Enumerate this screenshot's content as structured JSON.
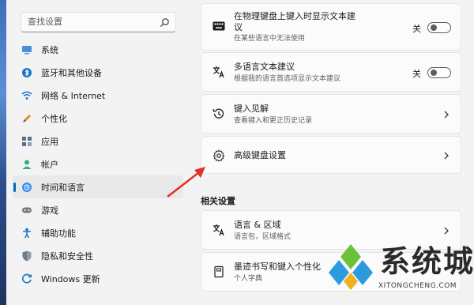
{
  "search": {
    "placeholder": "查找设置"
  },
  "sidebar": {
    "items": [
      {
        "label": "系统",
        "icon": "system-icon"
      },
      {
        "label": "蓝牙和其他设备",
        "icon": "bluetooth-icon"
      },
      {
        "label": "网络 & Internet",
        "icon": "wifi-icon"
      },
      {
        "label": "个性化",
        "icon": "personalization-icon"
      },
      {
        "label": "应用",
        "icon": "apps-icon"
      },
      {
        "label": "帐户",
        "icon": "account-icon"
      },
      {
        "label": "时间和语言",
        "icon": "time-language-icon",
        "active": true
      },
      {
        "label": "游戏",
        "icon": "gaming-icon"
      },
      {
        "label": "辅助功能",
        "icon": "accessibility-icon"
      },
      {
        "label": "隐私和安全性",
        "icon": "privacy-shield-icon"
      },
      {
        "label": "Windows 更新",
        "icon": "windows-update-icon"
      }
    ]
  },
  "cards": {
    "physical_keyboard": {
      "title_line1": "在物理键盘上键入时显示文本建",
      "title_line2": "议",
      "subtitle": "在某些语言中无法使用",
      "toggle_label": "关",
      "toggle_on": false
    },
    "multilingual": {
      "title": "多语言文本建议",
      "subtitle": "根据我的语言首选项显示文本建议",
      "toggle_label": "关",
      "toggle_on": false
    },
    "typing_insights": {
      "title": "键入见解",
      "subtitle": "查看键入和更正历史记录"
    },
    "advanced_keyboard": {
      "title": "高级键盘设置"
    }
  },
  "related": {
    "section_title": "相关设置",
    "items": [
      {
        "title": "语言 & 区域",
        "subtitle": "语言包，区域格式"
      },
      {
        "title": "墨迹书写和键入个性化",
        "subtitle": "个人字典"
      }
    ]
  },
  "watermark": {
    "text": "系统城",
    "url": "XITONGCHENG.COM"
  },
  "colors": {
    "accent": "#0067c0",
    "arrow": "#e0302a"
  }
}
